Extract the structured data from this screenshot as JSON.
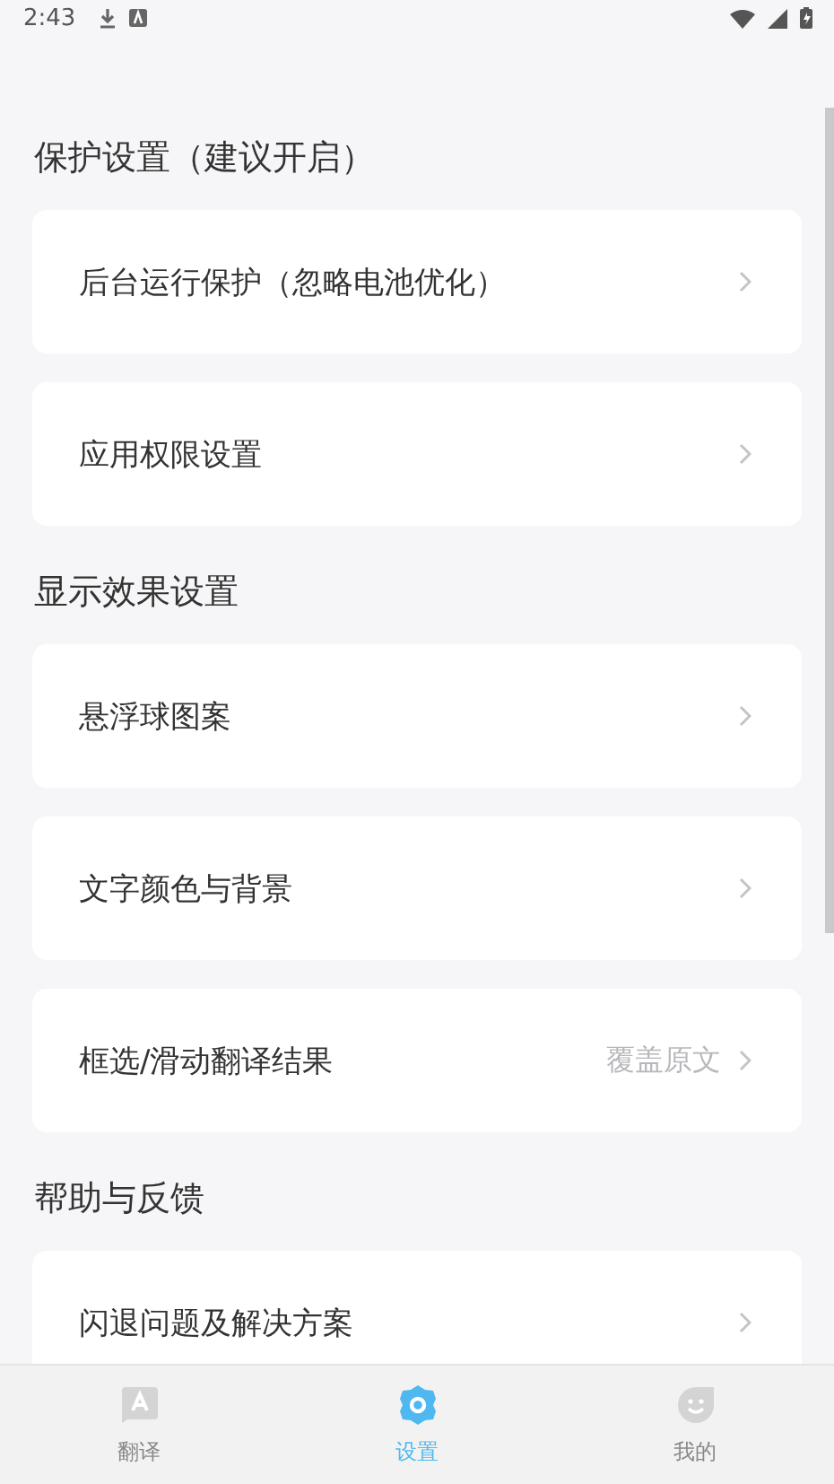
{
  "status_bar": {
    "time": "2:43"
  },
  "sections": [
    {
      "title": "保护设置（建议开启）",
      "items": [
        {
          "label": "后台运行保护（忽略电池优化）"
        },
        {
          "label": "应用权限设置"
        }
      ]
    },
    {
      "title": "显示效果设置",
      "items": [
        {
          "label": "悬浮球图案"
        },
        {
          "label": "文字颜色与背景"
        },
        {
          "label": "框选/滑动翻译结果",
          "value": "覆盖原文"
        }
      ]
    },
    {
      "title": "帮助与反馈",
      "items": [
        {
          "label": "闪退问题及解决方案"
        }
      ]
    }
  ],
  "tabs": [
    {
      "label": "翻译",
      "kind": "translate",
      "selected": false
    },
    {
      "label": "设置",
      "kind": "settings",
      "selected": true
    },
    {
      "label": "我的",
      "kind": "profile",
      "selected": false
    }
  ]
}
